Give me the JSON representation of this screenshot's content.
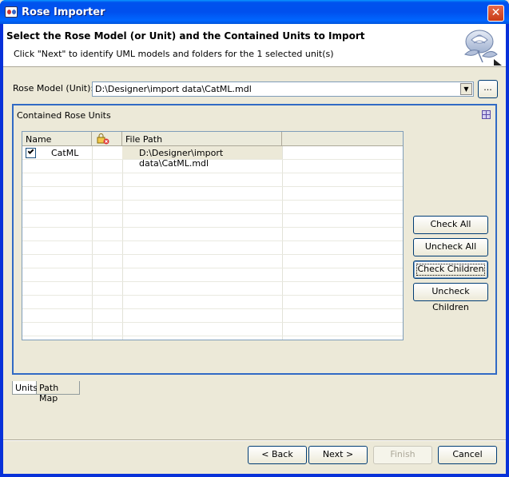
{
  "window": {
    "title": "Rose Importer",
    "close_glyph": "✕"
  },
  "header": {
    "title": "Select the Rose Model (or Unit) and the Contained Units to Import",
    "description": "Click \"Next\" to identify UML models and folders for the 1 selected unit(s)",
    "logo_icon": "rose-icon"
  },
  "rose_model": {
    "label": "Rose Model (Unit):",
    "value": "D:\\Designer\\import data\\CatML.mdl",
    "browse_label": "..."
  },
  "units_panel": {
    "title": "Contained Rose Units",
    "columns": {
      "name": "Name",
      "status_icon": "locked-error-icon",
      "path": "File Path"
    },
    "rows": [
      {
        "checked": true,
        "name": "CatML",
        "path": "D:\\Designer\\import data\\CatML.mdl"
      }
    ],
    "buttons": {
      "check_all": "Check All",
      "uncheck_all": "Uncheck All",
      "check_children": "Check Children",
      "uncheck_children": "Uncheck Children"
    }
  },
  "tabs": [
    {
      "label": "Units",
      "active": true
    },
    {
      "label": "Path Map",
      "active": false
    }
  ],
  "footer": {
    "back": "< Back",
    "next": "Next >",
    "finish": "Finish",
    "cancel": "Cancel"
  }
}
